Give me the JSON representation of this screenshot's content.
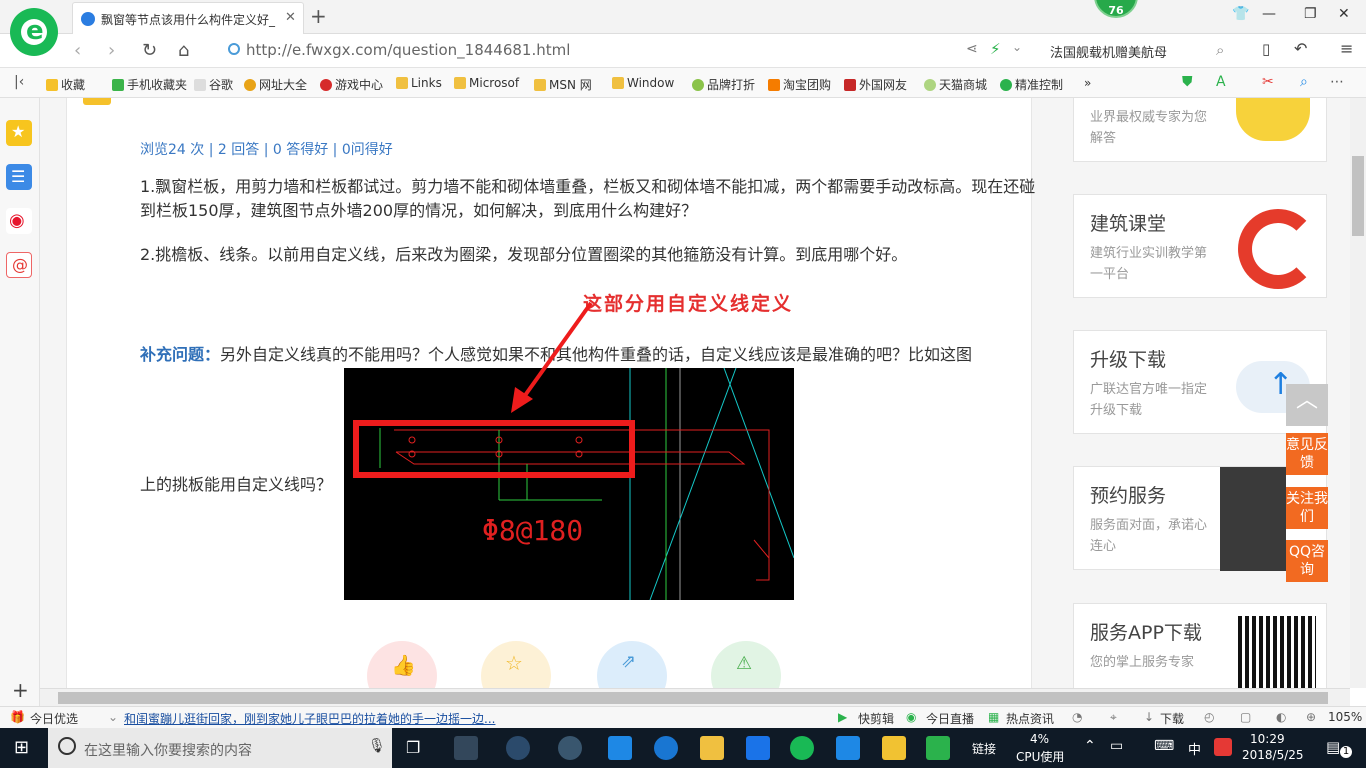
{
  "tab": {
    "title": "飘窗等节点该用什么构件定义好_",
    "badge": "76"
  },
  "address": {
    "url": "http://e.fwxgx.com/question_1844681.html",
    "search": "法国舰载机赠美航母"
  },
  "bookmarks": [
    "收藏",
    "手机收藏夹",
    "谷歌",
    "网址大全",
    "游戏中心",
    "Links",
    "Microsof",
    "MSN 网",
    "Window",
    "品牌打折",
    "淘宝团购",
    "外国网友",
    "天猫商城",
    "精准控制"
  ],
  "question": {
    "stats": "浏览24 次 | 2 回答 | 0 答得好 | 0问得好",
    "p1": "1.飘窗栏板，用剪力墙和栏板都试过。剪力墙不能和砌体墙重叠，栏板又和砌体墙不能扣减，两个都需要手动改标高。现在还碰到栏板150厚，建筑图节点外墙200厚的情况，如何解决，到底用什么构建好？",
    "p2": "2.挑檐板、线条。以前用自定义线，后来改为圈梁，发现部分位置圈梁的其他箍筋没有计算。到底用哪个好。",
    "supp_label": "补充问题：",
    "supp_text": "另外自定义线真的不能用吗？个人感觉如果不和其他构件重叠的话，自定义线应该是最准确的吧？比如这图",
    "supp_tail": "上的挑板能用自定义线吗？",
    "annotation": "这部分用自定义线定义",
    "cad_text": "Φ8@180"
  },
  "right_cards": [
    {
      "title": "",
      "desc": "业界最权威专家为您解答"
    },
    {
      "title": "建筑课堂",
      "desc": "建筑行业实训教学第一平台"
    },
    {
      "title": "升级下载",
      "desc": "广联达官方唯一指定升级下载"
    },
    {
      "title": "预约服务",
      "desc": "服务面对面，承诺心连心"
    },
    {
      "title": "服务APP下载",
      "desc": "您的掌上服务专家"
    }
  ],
  "float_buttons": [
    "意见反馈",
    "关注我们",
    "QQ咨询"
  ],
  "statusbar": {
    "news_label": "今日优选",
    "news": "和闺蜜蹦儿逛街回家，刚到家她儿子眼巴巴的拉着她的手一边摇一边...",
    "kuaijian": "快剪辑",
    "live": "今日直播",
    "hot": "热点资讯",
    "download": "下载",
    "zoom": "105%"
  },
  "taskbar": {
    "search_placeholder": "在这里输入你要搜索的内容",
    "link": "链接",
    "cpu": "4%",
    "cpu_label": "CPU使用",
    "ime": "中",
    "time": "10:29",
    "date": "2018/5/25",
    "notif": "1"
  }
}
